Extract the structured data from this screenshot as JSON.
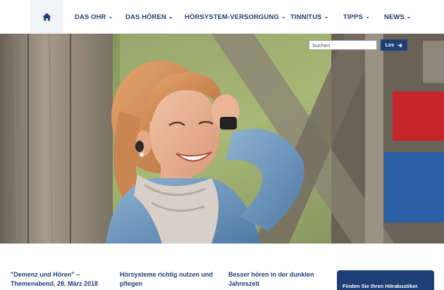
{
  "nav": {
    "home_icon": "home-icon",
    "items": [
      {
        "label": "DAS OHR"
      },
      {
        "label": "DAS HÖREN"
      },
      {
        "label": "HÖRSYSTEM-VERSORGUNG"
      },
      {
        "label": "TINNITUS"
      },
      {
        "label": "TIPPS"
      },
      {
        "label": "NEWS"
      }
    ],
    "chevron_icon": "chevron-down-icon"
  },
  "search": {
    "placeholder": "Suchen",
    "value": "",
    "button_label": "Los",
    "button_icon": "arrow-right-icon"
  },
  "hero": {
    "image": "woman-with-hearing-aid-smiling-photo"
  },
  "teasers": [
    {
      "line1": "\"Demenz und Hören\" –",
      "line2": "Themenabend, 28. März 2018"
    },
    {
      "line1": "Hörsysteme richtig nutzen und",
      "line2": "pflegen"
    },
    {
      "line1": "Besser hören in der dunklen",
      "line2": "Jahreszeit"
    }
  ],
  "finder": {
    "label": "Finden Sie Ihren Hörakustiker."
  },
  "colors": {
    "brand": "#1d3f76",
    "nav_bg": "#ffffff",
    "home_bg": "#f1f3f5"
  }
}
